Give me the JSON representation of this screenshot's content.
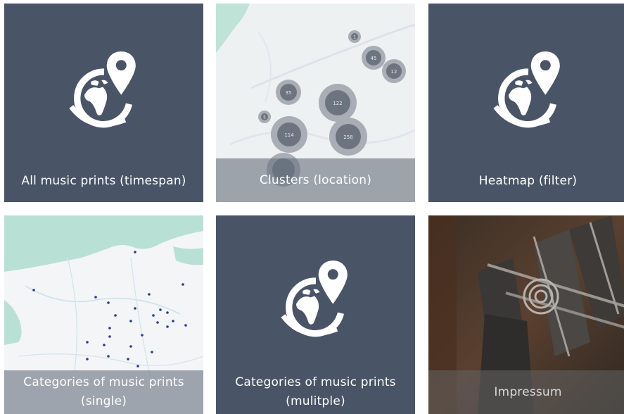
{
  "tiles": [
    {
      "label": "All music prints (timespan)",
      "icon": "globe-pin-icon"
    },
    {
      "label": "Clusters (location)",
      "clusters": [
        "1",
        "45",
        "12",
        "35",
        "122",
        "5",
        "114",
        "258"
      ]
    },
    {
      "label": "Heatmap (filter)",
      "icon": "globe-pin-icon"
    },
    {
      "label_line1": "Categories of music prints",
      "label_line2": "(single)"
    },
    {
      "label_line1": "Categories of music prints",
      "label_line2": "(mulitple)",
      "icon": "globe-pin-icon"
    },
    {
      "label": "Impressum"
    }
  ],
  "colors": {
    "tile_bg": "#495466",
    "map_water": "#b9e0d4",
    "map_land": "#f3f5f6",
    "marker": "#2a3b8f"
  }
}
